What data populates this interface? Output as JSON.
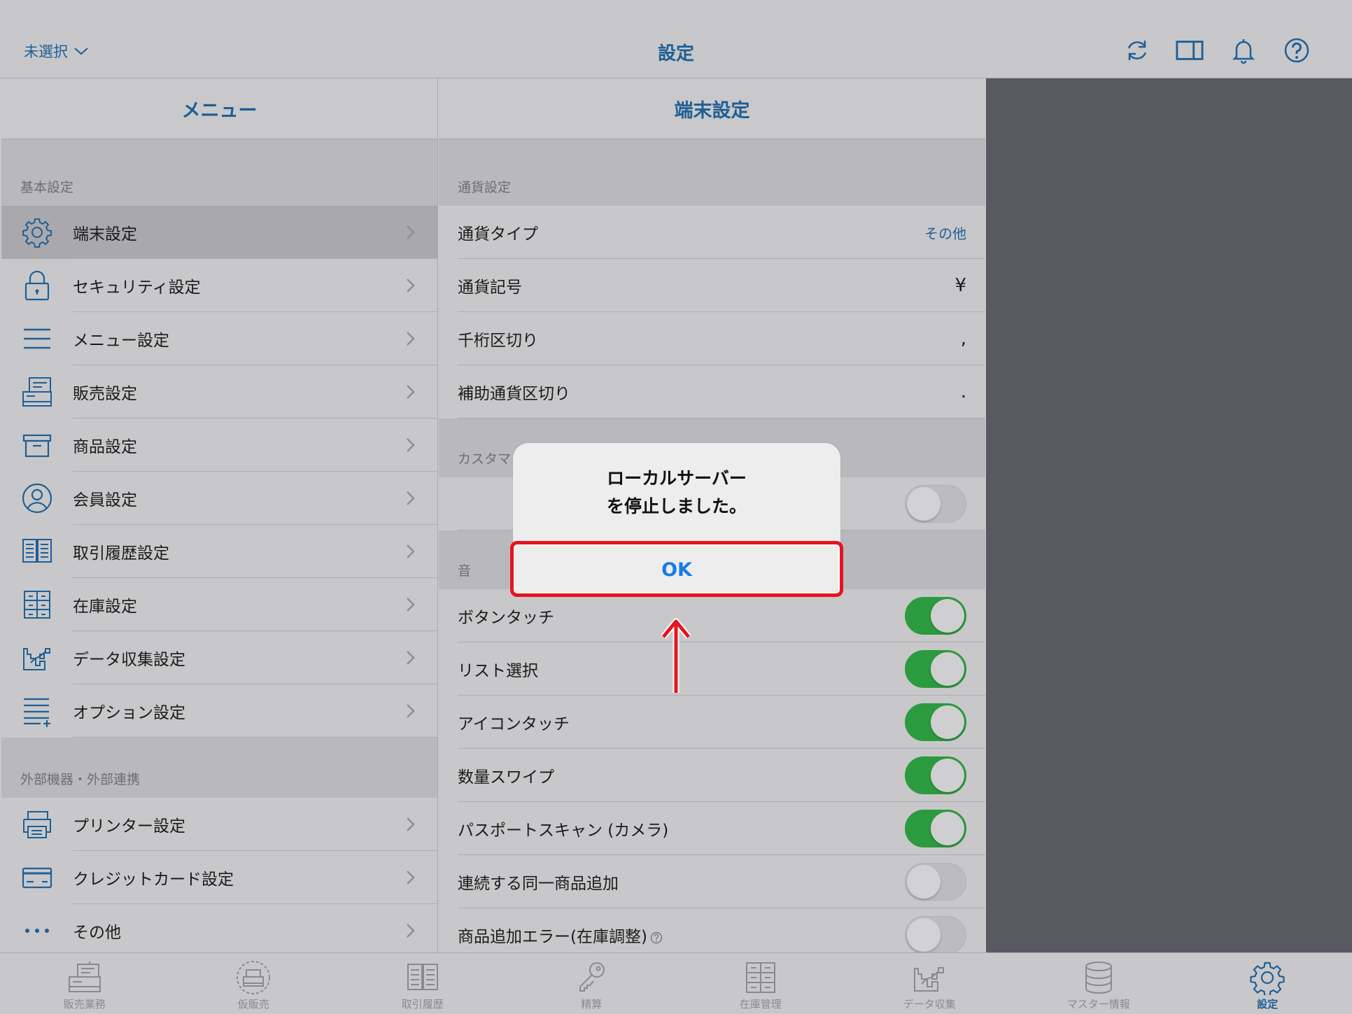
{
  "topbar": {
    "store_label": "未選択",
    "title": "設定",
    "icons": [
      "refresh-icon",
      "split-view-icon",
      "bell-icon",
      "help-icon"
    ]
  },
  "menu": {
    "header": "メニュー",
    "groups": [
      {
        "label": "基本設定",
        "items": [
          {
            "label": "端末設定",
            "icon": "gear-icon",
            "selected": true
          },
          {
            "label": "セキュリティ設定",
            "icon": "lock-icon"
          },
          {
            "label": "メニュー設定",
            "icon": "hamburger-icon"
          },
          {
            "label": "販売設定",
            "icon": "register-icon"
          },
          {
            "label": "商品設定",
            "icon": "box-icon"
          },
          {
            "label": "会員設定",
            "icon": "person-icon"
          },
          {
            "label": "取引履歴設定",
            "icon": "book-icon"
          },
          {
            "label": "在庫設定",
            "icon": "shelf-icon"
          },
          {
            "label": "データ収集設定",
            "icon": "chart-icon"
          },
          {
            "label": "オプション設定",
            "icon": "list-plus-icon"
          }
        ]
      },
      {
        "label": "外部機器・外部連携",
        "items": [
          {
            "label": "プリンター設定",
            "icon": "printer-icon"
          },
          {
            "label": "クレジットカード設定",
            "icon": "card-icon"
          },
          {
            "label": "その他",
            "icon": "more-icon"
          }
        ]
      }
    ]
  },
  "detail": {
    "header": "端末設定",
    "currency_group": "通貨設定",
    "currency_rows": [
      {
        "label": "通貨タイプ",
        "value": "その他"
      },
      {
        "label": "通貨記号",
        "value": "¥"
      },
      {
        "label": "千桁区切り",
        "value": ","
      },
      {
        "label": "補助通貨区切り",
        "value": "."
      }
    ],
    "customer_group": "カスタマ",
    "sound_group": "音",
    "sound_rows": [
      {
        "label": "ボタンタッチ",
        "on": true
      },
      {
        "label": "リスト選択",
        "on": true
      },
      {
        "label": "アイコンタッチ",
        "on": true
      },
      {
        "label": "数量スワイプ",
        "on": true
      },
      {
        "label": "パスポートスキャン (カメラ)",
        "on": true
      },
      {
        "label": "連続する同一商品追加",
        "on": false
      },
      {
        "label": "商品追加エラー(在庫調整)",
        "on": false
      }
    ]
  },
  "dialog": {
    "line1": "ローカルサーバー",
    "line2": "を停止しました。",
    "ok_label": "OK"
  },
  "tabs": [
    {
      "label": "販売業務",
      "icon": "register-icon"
    },
    {
      "label": "仮販売",
      "icon": "temp-sale-icon"
    },
    {
      "label": "取引履歴",
      "icon": "book-icon"
    },
    {
      "label": "精算",
      "icon": "key-icon"
    },
    {
      "label": "在庫管理",
      "icon": "shelf-icon"
    },
    {
      "label": "データ収集",
      "icon": "chart-icon"
    },
    {
      "label": "マスター情報",
      "icon": "database-icon"
    },
    {
      "label": "設定",
      "icon": "gear-icon",
      "active": true
    }
  ],
  "colors": {
    "accent": "#1f5f95",
    "toggle_on": "#2c9a3e",
    "highlight": "#e5141e",
    "ok_blue": "#1a7ae6"
  }
}
